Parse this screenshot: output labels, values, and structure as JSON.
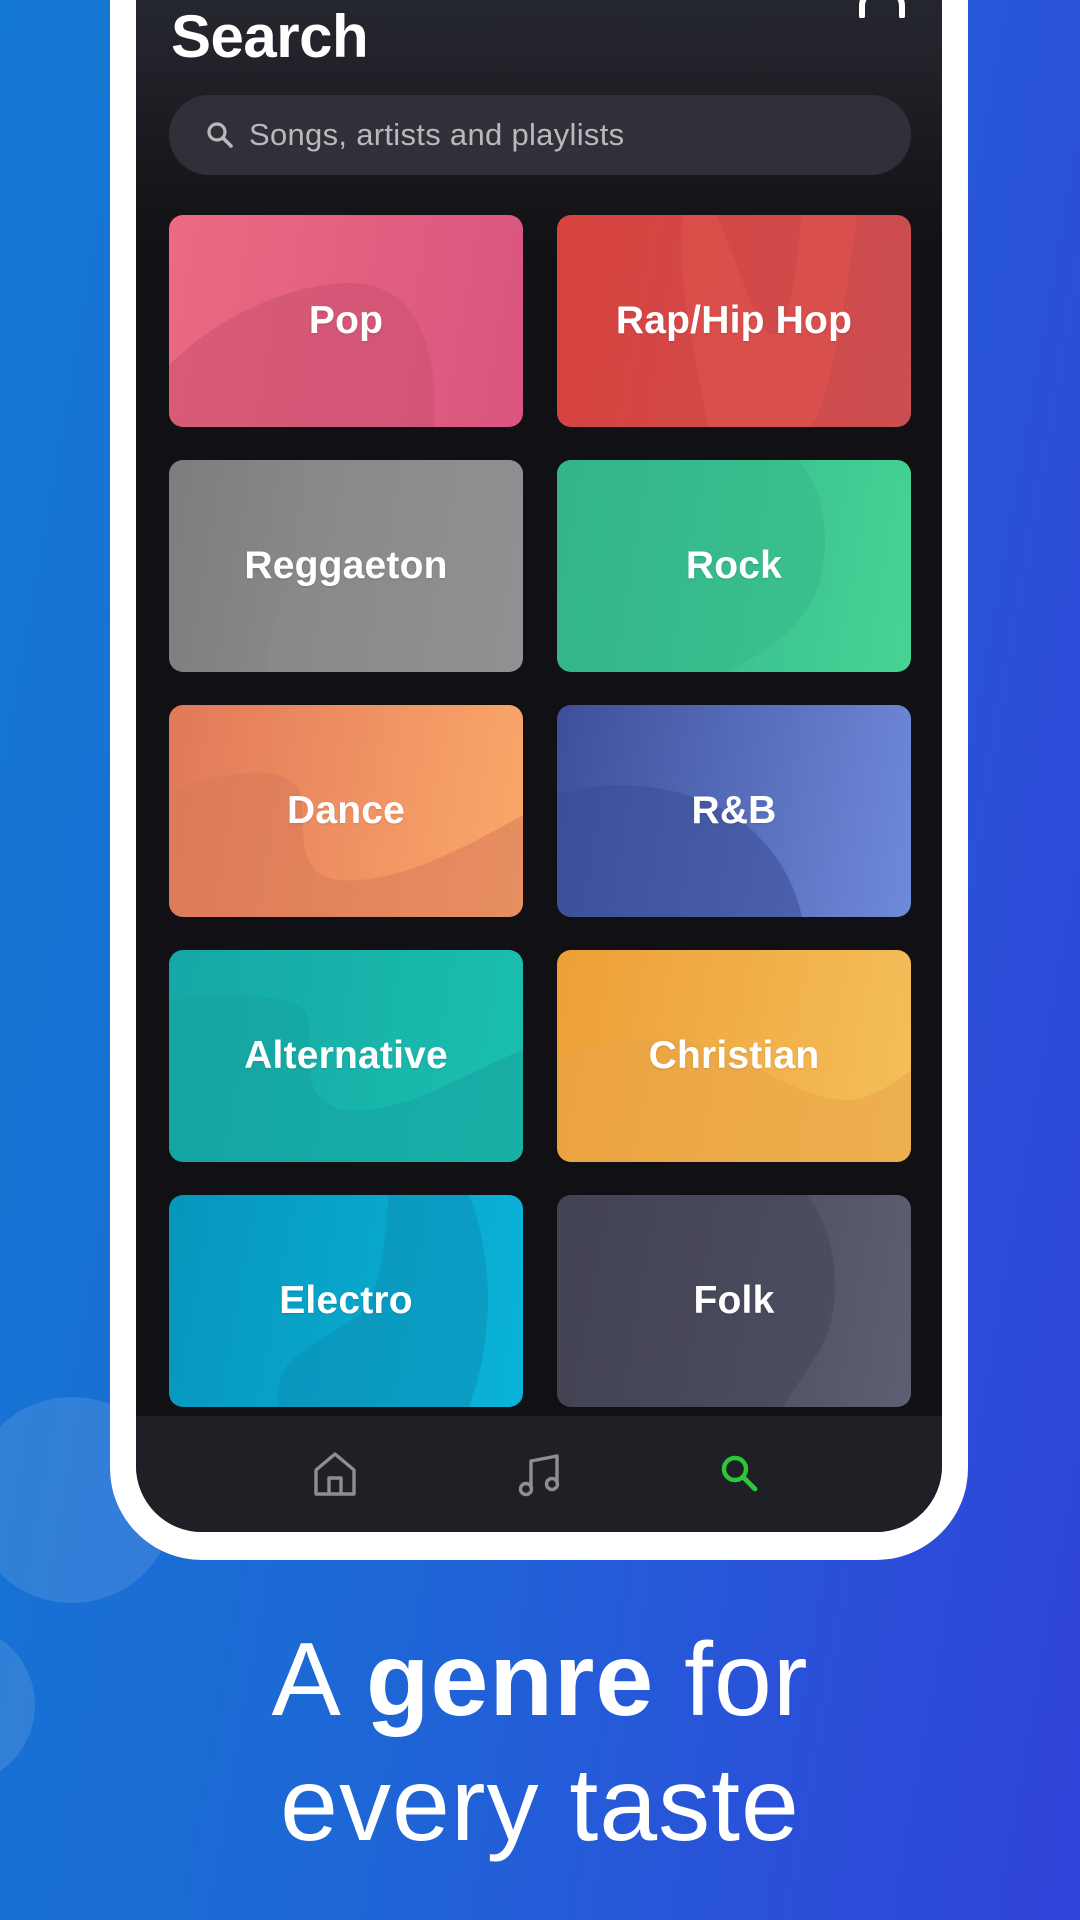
{
  "app": {
    "title": "Search",
    "search": {
      "placeholder": "Songs, artists and playlists",
      "value": ""
    },
    "genres": [
      {
        "label": "Pop",
        "color_from": "#ec6a82",
        "color_to": "#d9557f",
        "shape": "#c9516f"
      },
      {
        "label": "Rap/Hip Hop",
        "color_from": "#d8433f",
        "color_to": "#cb4e50",
        "shape": "#e0544f"
      },
      {
        "label": "Reggaeton",
        "color_from": "#7d7d7f",
        "color_to": "#9a999b",
        "shape": "#8a898b"
      },
      {
        "label": "Rock",
        "color_from": "#2fae8e",
        "color_to": "#46d494",
        "shape": "#37b888"
      },
      {
        "label": "Dance",
        "color_from": "#e1785a",
        "color_to": "#fba96a",
        "shape": "#d77a59"
      },
      {
        "label": "R&B",
        "color_from": "#3e4f9a",
        "color_to": "#6f8ada",
        "shape": "#3a4d94"
      },
      {
        "label": "Alternative",
        "color_from": "#15a7a6",
        "color_to": "#1bbfae",
        "shape": "#16a2a0"
      },
      {
        "label": "Christian",
        "color_from": "#ee9e37",
        "color_to": "#f4bf5a",
        "shape": "#e9a447"
      },
      {
        "label": "Electro",
        "color_from": "#0796bd",
        "color_to": "#0ab3d8",
        "shape": "#0b8fb6"
      },
      {
        "label": "Folk",
        "color_from": "#3d3e4a",
        "color_to": "#5e5f73",
        "shape": "#45465a"
      }
    ],
    "nav": [
      {
        "name": "home",
        "icon": "home-icon",
        "active": false
      },
      {
        "name": "library",
        "icon": "music-note-icon",
        "active": false
      },
      {
        "name": "search",
        "icon": "search-icon",
        "active": true
      }
    ],
    "colors": {
      "nav_inactive": "#8d8d92",
      "nav_active": "#2bc939"
    }
  },
  "tagline": {
    "line1_pre": "A ",
    "line1_bold": "genre",
    "line1_post": " for",
    "line2": "every taste"
  }
}
